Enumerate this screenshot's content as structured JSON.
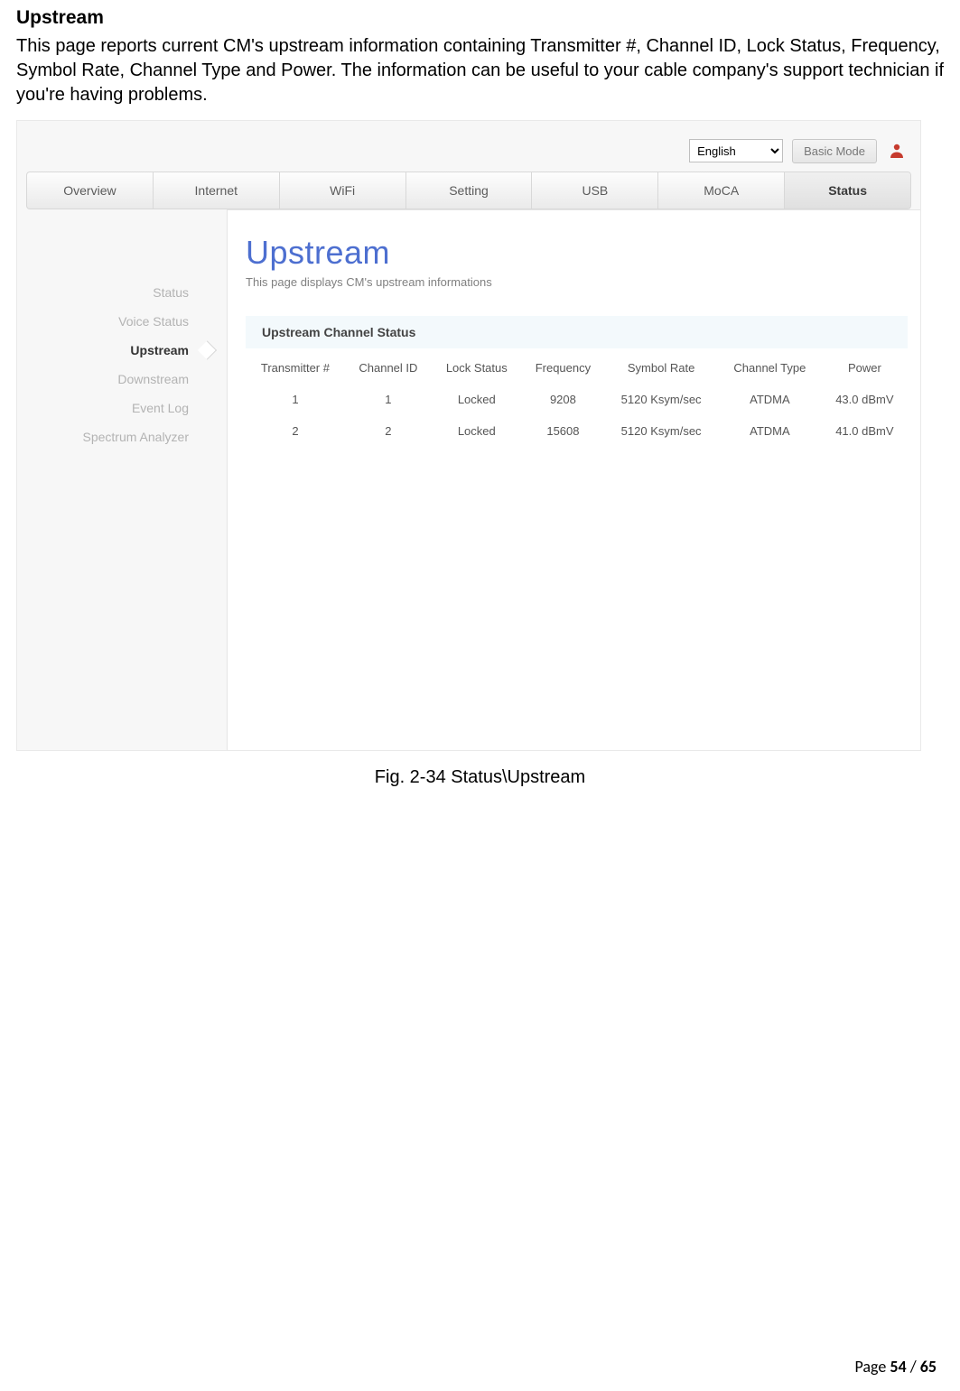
{
  "section_title": "Upstream",
  "section_desc": "This page reports current CM's upstream information containing Transmitter #, Channel ID, Lock Status, Frequency, Symbol Rate, Channel Type and Power. The information can be useful to your cable company's support technician if you're having problems.",
  "figure": {
    "language": "English",
    "basic_mode": "Basic Mode",
    "nav": [
      "Overview",
      "Internet",
      "WiFi",
      "Setting",
      "USB",
      "MoCA",
      "Status"
    ],
    "sidebar": [
      "Status",
      "Voice Status",
      "Upstream",
      "Downstream",
      "Event Log",
      "Spectrum Analyzer"
    ],
    "content_title": "Upstream",
    "content_sub": "This page displays CM's upstream informations",
    "table_title": "Upstream Channel Status",
    "columns": [
      "Transmitter #",
      "Channel ID",
      "Lock Status",
      "Frequency",
      "Symbol Rate",
      "Channel Type",
      "Power"
    ],
    "rows": [
      {
        "tx": "1",
        "cid": "1",
        "lock": "Locked",
        "freq": "9208",
        "rate": "5120 Ksym/sec",
        "type": "ATDMA",
        "power": "43.0 dBmV"
      },
      {
        "tx": "2",
        "cid": "2",
        "lock": "Locked",
        "freq": "15608",
        "rate": "5120 Ksym/sec",
        "type": "ATDMA",
        "power": "41.0 dBmV"
      }
    ]
  },
  "caption": "Fig. 2-34 Status\\Upstream",
  "footer": {
    "prefix": "Page ",
    "page": "54",
    "sep": " / ",
    "total": "65"
  }
}
